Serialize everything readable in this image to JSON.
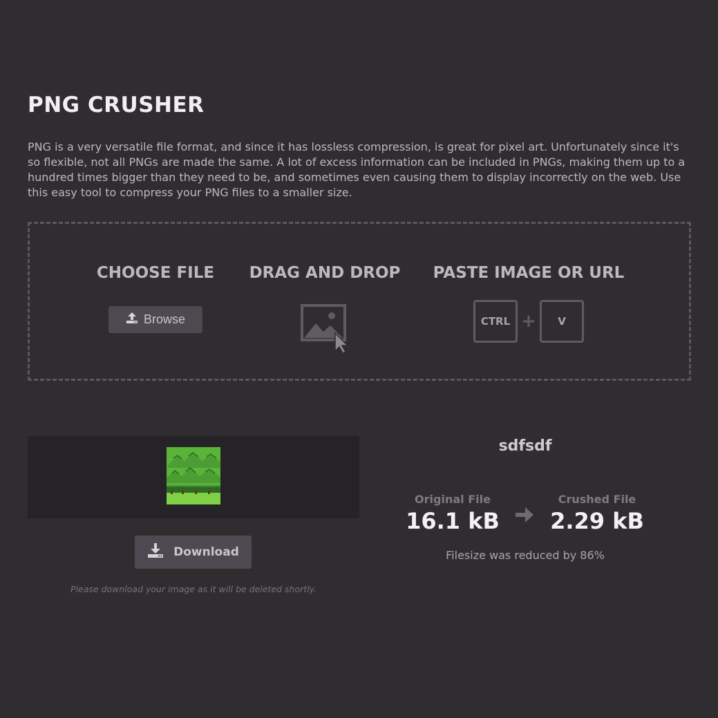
{
  "header": {
    "title": "PNG CRUSHER",
    "description": "PNG is a very versatile file format, and since it has lossless compression, is great for pixel art. Unfortunately since it's so flexible, not all PNGs are made the same. A lot of excess information can be included in PNGs, making them up to a hundred times bigger than they need to be, and sometimes even causing them to display incorrectly on the web. Use this easy tool to compress your PNG files to a smaller size."
  },
  "upload": {
    "choose_file_title": "CHOOSE FILE",
    "browse_label": "Browse",
    "drag_drop_title": "DRAG AND DROP",
    "paste_title": "PASTE IMAGE OR URL",
    "key_ctrl": "CTRL",
    "key_plus": "+",
    "key_v": "V"
  },
  "result": {
    "download_label": "Download",
    "note": "Please download your image as it will be deleted shortly.",
    "file_name": "sdfsdf",
    "original_label": "Original File",
    "original_size": "16.1 kB",
    "crushed_label": "Crushed File",
    "crushed_size": "2.29 kB",
    "reduction_text": "Filesize was reduced by 86%"
  },
  "icons": {
    "browse": "upload-icon",
    "drag_drop": "image-cursor-icon",
    "download": "download-icon",
    "compare": "arrow-right-icon"
  },
  "colors": {
    "background": "#302d31",
    "button": "#4d4950",
    "preview_bg": "#252328",
    "thumbnail_green": "#5ab43a"
  }
}
